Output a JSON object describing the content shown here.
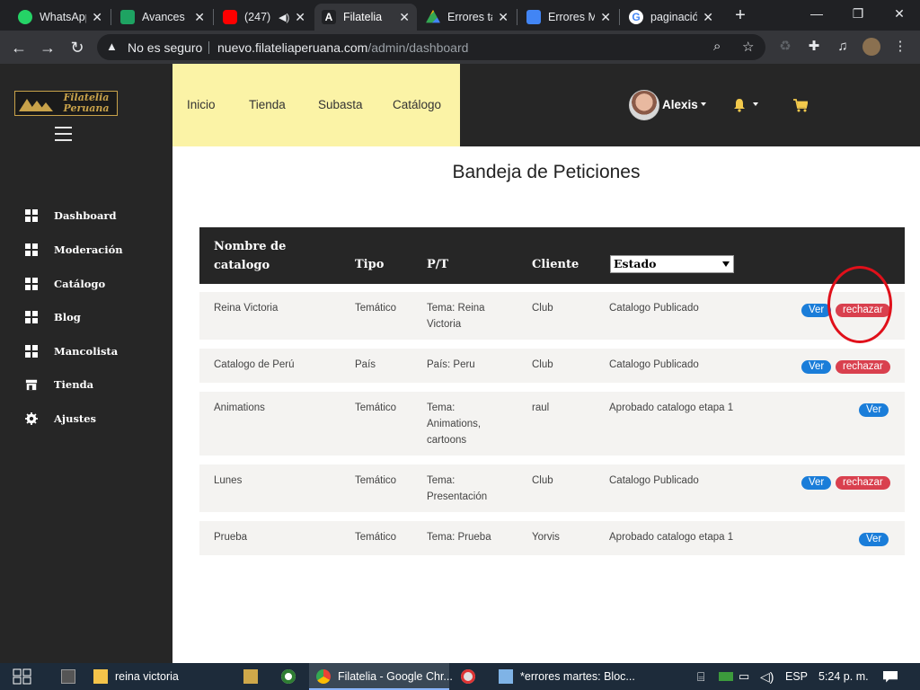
{
  "browser": {
    "tabs": [
      {
        "title": "WhatsApp",
        "icon": "whatsapp-icon",
        "color": "#25d366"
      },
      {
        "title": "Avances I",
        "icon": "sheets-icon",
        "color": "#1ea362"
      },
      {
        "title": "(247)",
        "icon": "youtube-icon",
        "color": "#ff0000"
      },
      {
        "title": "Filatelia",
        "icon": "angular-icon",
        "color": "#ffffff"
      },
      {
        "title": "Errores ta",
        "icon": "drive-icon",
        "color": "#fbbc04"
      },
      {
        "title": "Errores M",
        "icon": "docs-icon",
        "color": "#4285f4"
      },
      {
        "title": "paginació",
        "icon": "google-icon",
        "color": "#ffffff"
      }
    ],
    "security_label": "No es seguro",
    "url_host": "nuevo.filateliaperuana.com",
    "url_path": "/admin/dashboard"
  },
  "brand": {
    "line1": "Filatelia",
    "line2": "Peruana",
    "color": "#c8a24a"
  },
  "sidebar": {
    "items": [
      {
        "label": "Dashboard",
        "icon": "dashboard-grid-icon"
      },
      {
        "label": "Moderación",
        "icon": "dashboard-grid-icon"
      },
      {
        "label": "Catálogo",
        "icon": "dashboard-grid-icon"
      },
      {
        "label": "Blog",
        "icon": "dashboard-grid-icon"
      },
      {
        "label": "Mancolista",
        "icon": "dashboard-grid-icon"
      },
      {
        "label": "Tienda",
        "icon": "store-icon"
      },
      {
        "label": "Ajustes",
        "icon": "gear-icon"
      }
    ]
  },
  "topnav": {
    "items": [
      "Inicio",
      "Tienda",
      "Subasta",
      "Catálogo"
    ],
    "user_name": "Alexis"
  },
  "main": {
    "title": "Bandeja de Peticiones",
    "table": {
      "headers": {
        "nombre_line1": "Nombre de",
        "nombre_line2": "catalogo",
        "tipo": "Tipo",
        "pt": "P/T",
        "cliente": "Cliente"
      },
      "estado_filter": "Estado",
      "rows": [
        {
          "nombre": "Reina Victoria",
          "tipo": "Temático",
          "pt": [
            "Tema: Reina",
            "Victoria"
          ],
          "cliente": "Club",
          "estado": "Catalogo Publicado",
          "ver": "Ver",
          "rechazar": "rechazar"
        },
        {
          "nombre": "Catalogo de Perú",
          "tipo": "País",
          "pt": [
            "País: Peru"
          ],
          "cliente": "Club",
          "estado": "Catalogo Publicado",
          "ver": "Ver",
          "rechazar": "rechazar"
        },
        {
          "nombre": "Animations",
          "tipo": "Temático",
          "pt": [
            "Tema:",
            "Animations,",
            "cartoons"
          ],
          "cliente": "raul",
          "estado": "Aprobado catalogo etapa 1",
          "ver": "Ver",
          "rechazar": null
        },
        {
          "nombre": "Lunes",
          "tipo": "Temático",
          "pt": [
            "Tema:",
            "Presentación"
          ],
          "cliente": "Club",
          "estado": "Catalogo Publicado",
          "ver": "Ver",
          "rechazar": "rechazar"
        },
        {
          "nombre": "Prueba",
          "tipo": "Temático",
          "pt": [
            "Tema: Prueba"
          ],
          "cliente": "Yorvis",
          "estado": "Aprobado catalogo etapa 1",
          "ver": "Ver",
          "rechazar": null
        }
      ]
    }
  },
  "taskbar": {
    "items": [
      {
        "label": "reina victoria",
        "icon": "folder-icon"
      },
      {
        "label": "Filatelia - Google Chr...",
        "icon": "chrome-icon"
      },
      {
        "label": "*errores martes: Bloc...",
        "icon": "notepad-icon"
      }
    ],
    "language": "ESP",
    "time": "5:24 p. m."
  },
  "colors": {
    "sidebar": "#262626",
    "topnav": "#fbf3a6",
    "ver": "#1a7dd9",
    "rechazar": "#d9404e",
    "annotation": "#e0101a"
  }
}
